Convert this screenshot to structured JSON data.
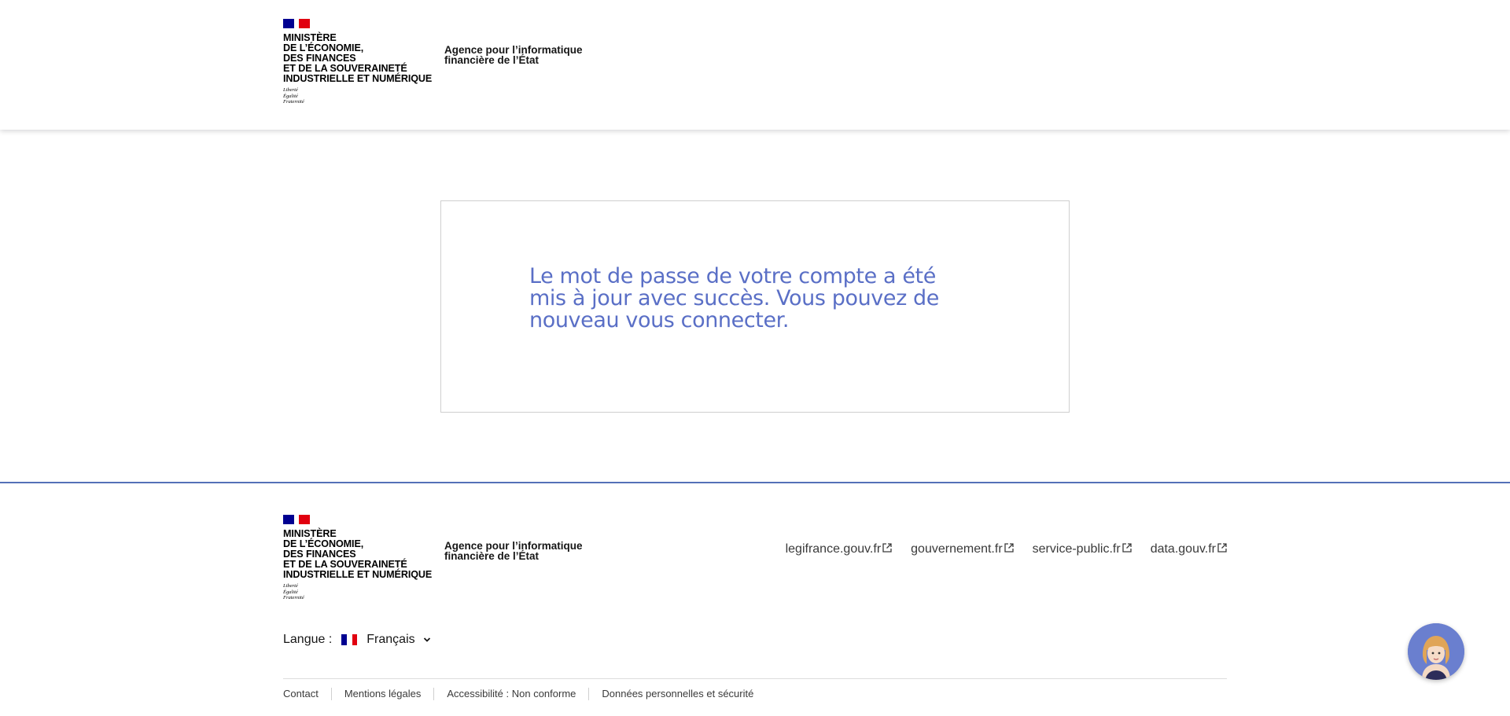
{
  "header": {
    "ministry_lines": "MINISTÈRE\nDE L’ÉCONOMIE,\nDES FINANCES\nET DE LA SOUVERAINETÉ\nINDUSTRIELLE ET NUMÉRIQUE",
    "devise": "Liberté\nÉgalité\nFraternité",
    "agency": "Agence pour l’informatique\nfinancière de l’État"
  },
  "main": {
    "message": "Le mot de passe de votre compte a été mis à jour avec succès. Vous pouvez de nouveau vous connecter."
  },
  "footer": {
    "ministry_lines": "MINISTÈRE\nDE L’ÉCONOMIE,\nDES FINANCES\nET DE LA SOUVERAINETÉ\nINDUSTRIELLE ET NUMÉRIQUE",
    "devise": "Liberté\nÉgalité\nFraternité",
    "agency": "Agence pour l’informatique\nfinancière de l’État",
    "external_links": [
      {
        "label": "legifrance.gouv.fr",
        "icon": "external-link-icon"
      },
      {
        "label": "gouvernement.fr",
        "icon": "external-link-icon"
      },
      {
        "label": "service-public.fr",
        "icon": "external-link-icon"
      },
      {
        "label": "data.gouv.fr",
        "icon": "external-link-icon"
      }
    ],
    "language": {
      "label": "Langue :",
      "selected": "Français",
      "flag_colors": [
        "#000091",
        "#ffffff",
        "#e1000f"
      ]
    },
    "bottom_links": [
      "Contact",
      "Mentions légales",
      "Accessibilité : Non conforme",
      "Données personnelles et sécurité"
    ]
  },
  "colors": {
    "message_text": "#5a6fc6",
    "footer_border": "#5570b8",
    "marianne_blue": "#000091",
    "marianne_red": "#e1000f"
  }
}
